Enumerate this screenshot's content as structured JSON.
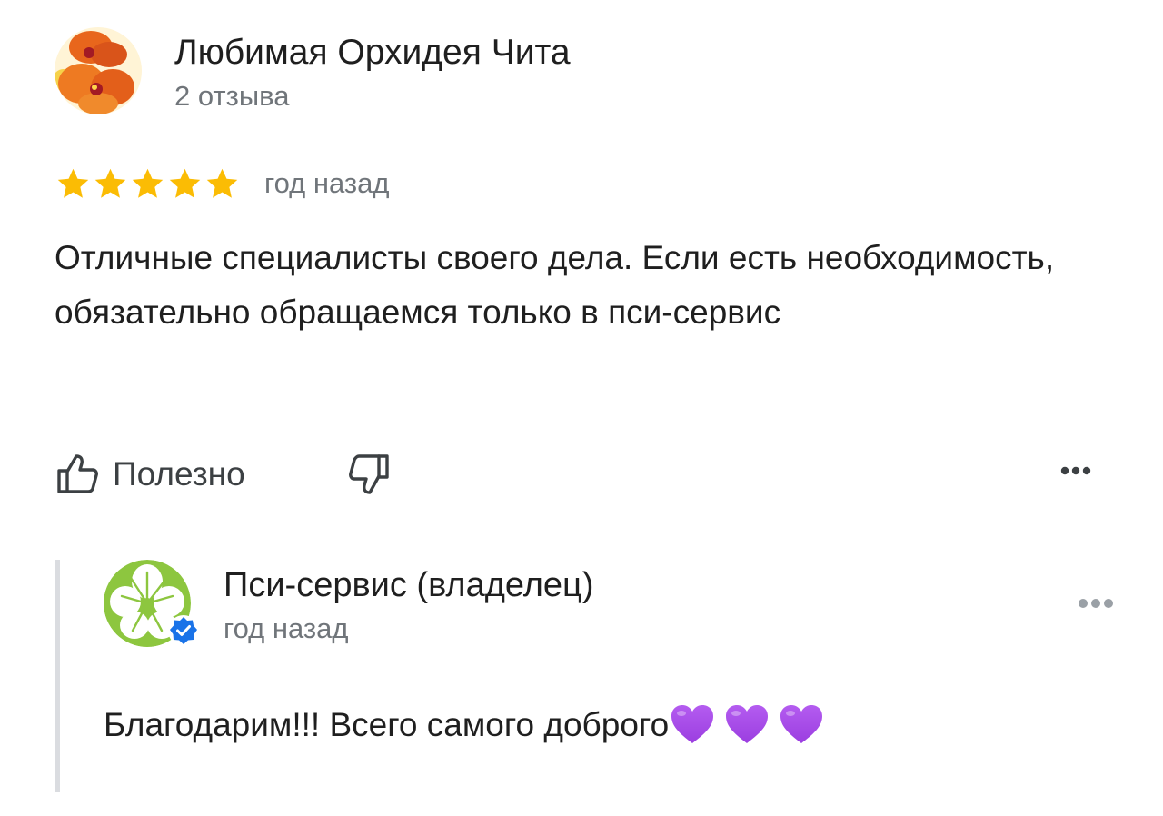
{
  "review": {
    "author": {
      "name": "Любимая Орхидея Чита",
      "meta": "2 отзыва"
    },
    "rating": 5,
    "date": "год назад",
    "text": "Отличные специалисты своего дела. Если есть необходимость, обязательно обращаемся только в пси-сервис",
    "actions": {
      "helpful_label": "Полезно"
    }
  },
  "reply": {
    "owner_name": "Пси-сервис (владелец)",
    "date": "год назад",
    "text": "Благодарим!!! Всего самого доброго",
    "hearts": 3,
    "heart_color": "#9b3ee0"
  },
  "colors": {
    "star": "#fbbc04",
    "secondary_text": "#70757a",
    "verified": "#1a73e8",
    "owner_logo_green": "#8dc63f"
  },
  "icons": {
    "avatar": "orchid-avatar",
    "rating": "star-icon",
    "helpful": "thumbs-up-icon",
    "not_helpful": "thumbs-down-icon",
    "more": "more-horizontal-icon",
    "verified": "verified-badge-icon",
    "emoji": "purple-heart-icon"
  }
}
